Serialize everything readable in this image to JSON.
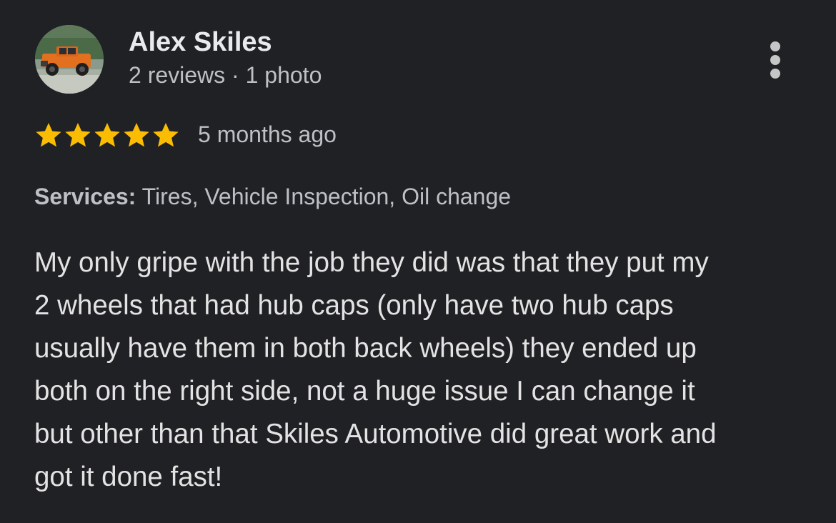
{
  "author": {
    "name": "Alex Skiles",
    "meta": "2 reviews · 1 photo"
  },
  "menu": {
    "icon": "more-vert-icon"
  },
  "rating": {
    "stars": 5,
    "max": 5,
    "color": "#fbbc04",
    "date": "5 months ago"
  },
  "services": {
    "label": "Services:",
    "value": "Tires, Vehicle Inspection, Oil change"
  },
  "review": {
    "lines": [
      "My only gripe with the job they did was that they put my",
      "2 wheels that had hub caps (only have two hub caps",
      "usually have them in both back wheels) they ended up",
      "both on the right side, not a huge issue I can change it",
      "but other than that Skiles Automotive did great work and",
      "got it done fast!"
    ]
  }
}
